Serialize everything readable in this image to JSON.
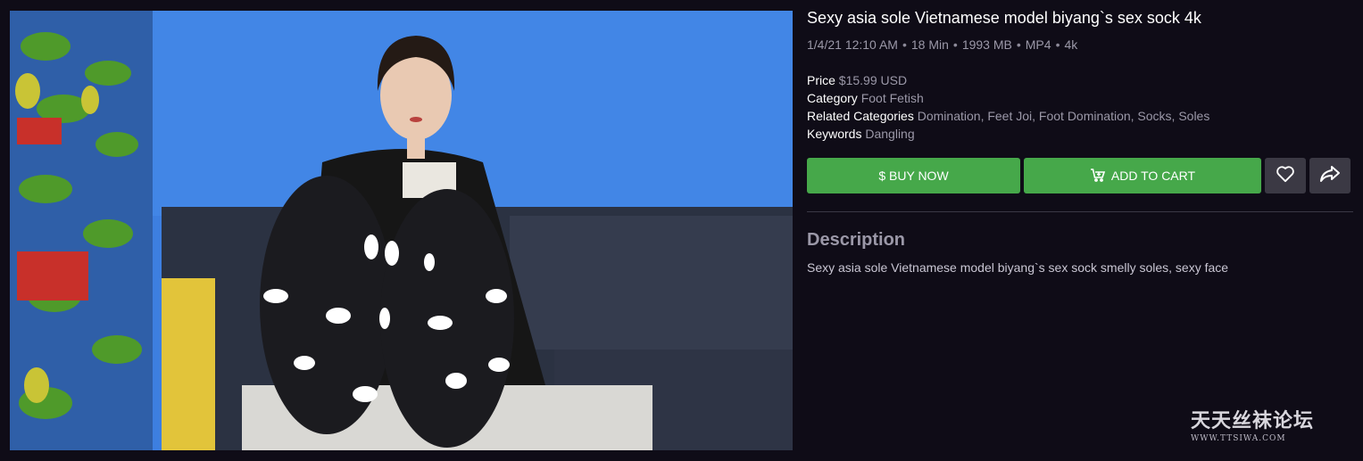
{
  "product": {
    "title": "Sexy asia sole Vietnamese model biyang`s sex sock 4k",
    "meta": {
      "date": "1/4/21 12:10 AM",
      "duration": "18 Min",
      "size": "1993 MB",
      "format": "MP4",
      "quality": "4k",
      "separator": "•"
    },
    "info": {
      "price_label": "Price",
      "price_value": "$15.99 USD",
      "category_label": "Category",
      "category_value": "Foot Fetish",
      "related_label": "Related Categories",
      "related_value": "Domination, Feet Joi, Foot Domination, Socks, Soles",
      "keywords_label": "Keywords",
      "keywords_value": "Dangling"
    }
  },
  "actions": {
    "buy_label": "$ BUY NOW",
    "cart_label": "ADD TO CART",
    "cart_icon": "cart-plus-icon",
    "favorite_icon": "heart-icon",
    "share_icon": "share-icon"
  },
  "description": {
    "heading": "Description",
    "text": "Sexy asia sole Vietnamese model biyang`s sex sock smelly soles, sexy face"
  },
  "watermark": {
    "main": "天天丝袜论坛",
    "sub": "WWW.TTSIWA.COM"
  },
  "colors": {
    "background": "#0f0c17",
    "accent_green": "#46a84a",
    "icon_button": "#3b3944",
    "muted_text": "#9b98a8"
  }
}
